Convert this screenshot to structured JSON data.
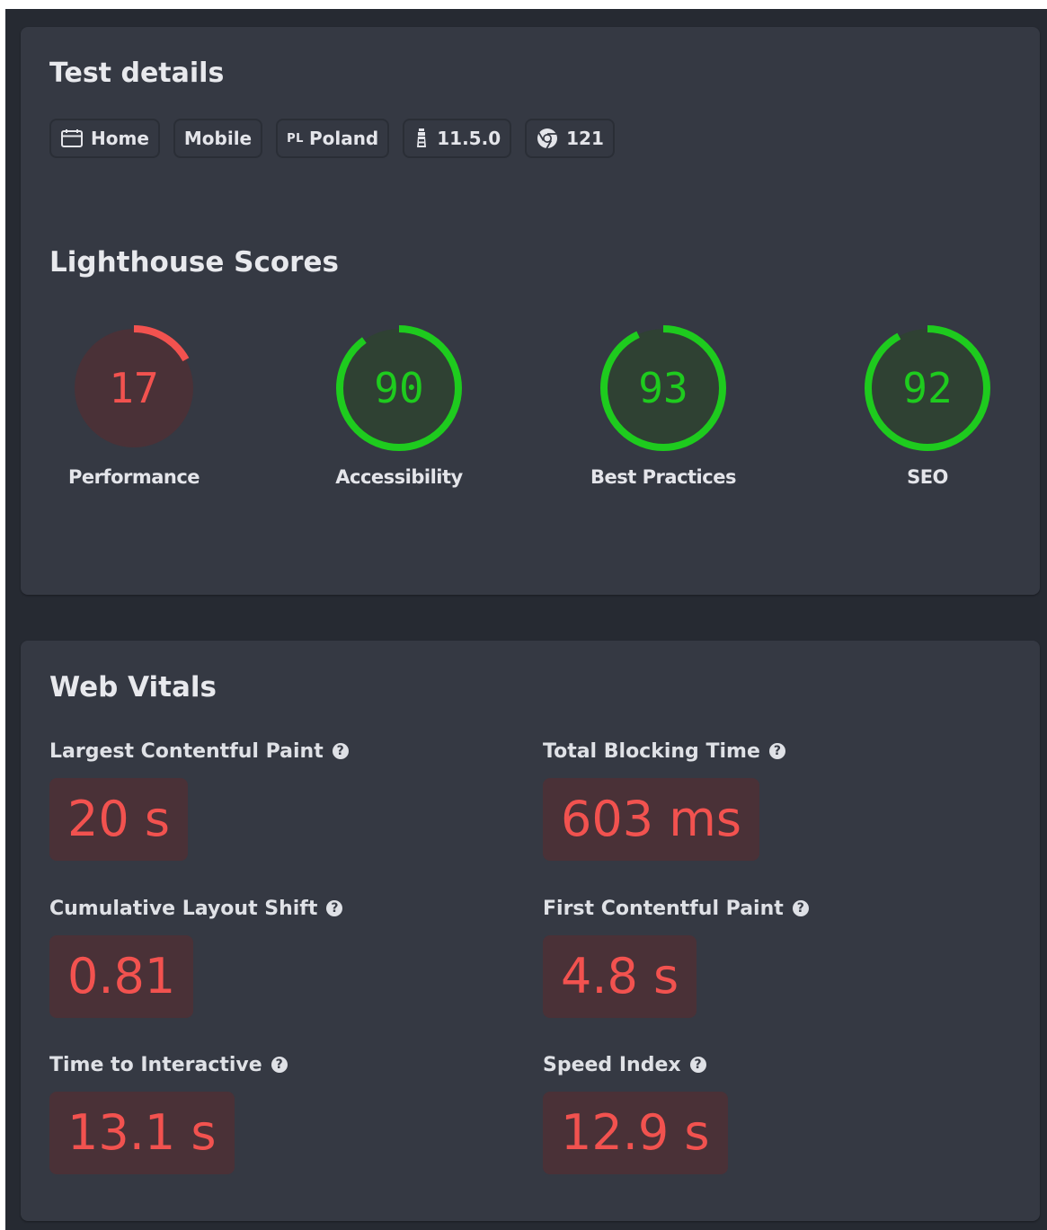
{
  "colors": {
    "page_background": "#262a32",
    "card_background": "#353943",
    "text": "#e8e9ed",
    "good": "#1ecb1e",
    "poor": "#f2524f",
    "poor_fill": "#4a3137",
    "good_fill": "#2f4133"
  },
  "test_details": {
    "title": "Test details",
    "chips": [
      {
        "label": "Home",
        "icon": "calendar-icon"
      },
      {
        "label": "Mobile"
      },
      {
        "label": "Poland",
        "prefix": "PL"
      },
      {
        "label": "11.5.0",
        "icon": "lighthouse-icon"
      },
      {
        "label": "121",
        "icon": "chrome-icon"
      }
    ]
  },
  "lighthouse": {
    "title": "Lighthouse Scores",
    "scores": [
      {
        "label": "Performance",
        "value": "17",
        "score": 17,
        "status": "poor"
      },
      {
        "label": "Accessibility",
        "value": "90",
        "score": 90,
        "status": "good"
      },
      {
        "label": "Best Practices",
        "value": "93",
        "score": 93,
        "status": "good"
      },
      {
        "label": "SEO",
        "value": "92",
        "score": 92,
        "status": "good"
      }
    ]
  },
  "web_vitals": {
    "title": "Web Vitals",
    "metrics": [
      {
        "label": "Largest Contentful Paint",
        "value": "20 s",
        "status": "poor"
      },
      {
        "label": "Total Blocking Time",
        "value": "603 ms",
        "status": "poor"
      },
      {
        "label": "Cumulative Layout Shift",
        "value": "0.81",
        "status": "poor"
      },
      {
        "label": "First Contentful Paint",
        "value": "4.8 s",
        "status": "poor"
      },
      {
        "label": "Time to Interactive",
        "value": "13.1 s",
        "status": "poor"
      },
      {
        "label": "Speed Index",
        "value": "12.9 s",
        "status": "poor"
      }
    ]
  }
}
